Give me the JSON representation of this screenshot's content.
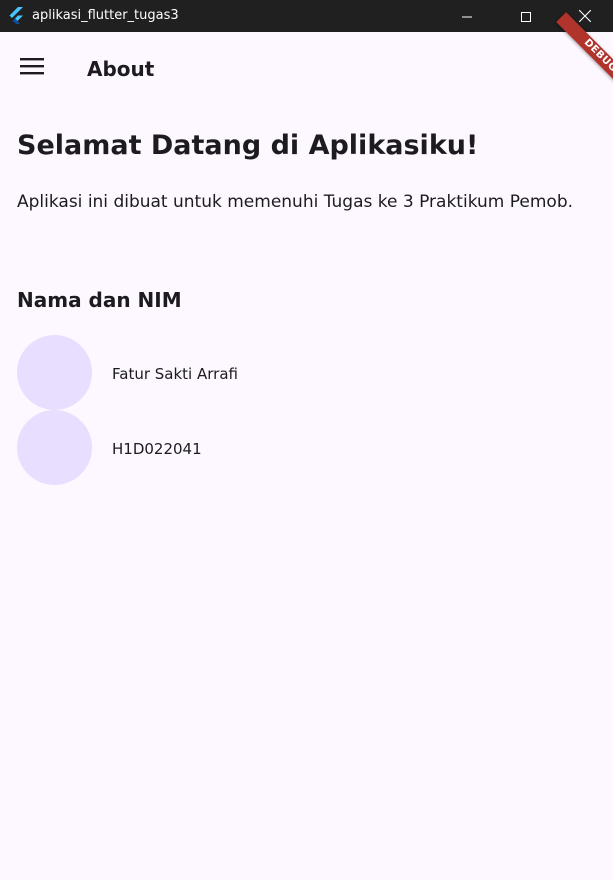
{
  "window": {
    "title": "aplikasi_flutter_tugas3",
    "icon": "flutter-logo-icon",
    "controls": [
      "minimize-icon",
      "maximize-icon",
      "close-icon"
    ]
  },
  "appbar": {
    "menu_icon": "menu-icon",
    "title": "About"
  },
  "debug_banner": {
    "label": "DEBUG",
    "color": "#b0332c"
  },
  "main": {
    "welcome_title": "Selamat Datang di Aplikasiku!",
    "description": "Aplikasi ini dibuat untuk memenuhi Tugas ke 3 Praktikum Pemob.",
    "section_title": "Nama dan NIM",
    "items": [
      {
        "text": "Fatur Sakti Arrafi"
      },
      {
        "text": "H1D022041"
      }
    ]
  },
  "colors": {
    "background": "#fdf7ff",
    "titlebar": "#202020",
    "avatar": "#e8deff",
    "text": "#1d1b20"
  }
}
